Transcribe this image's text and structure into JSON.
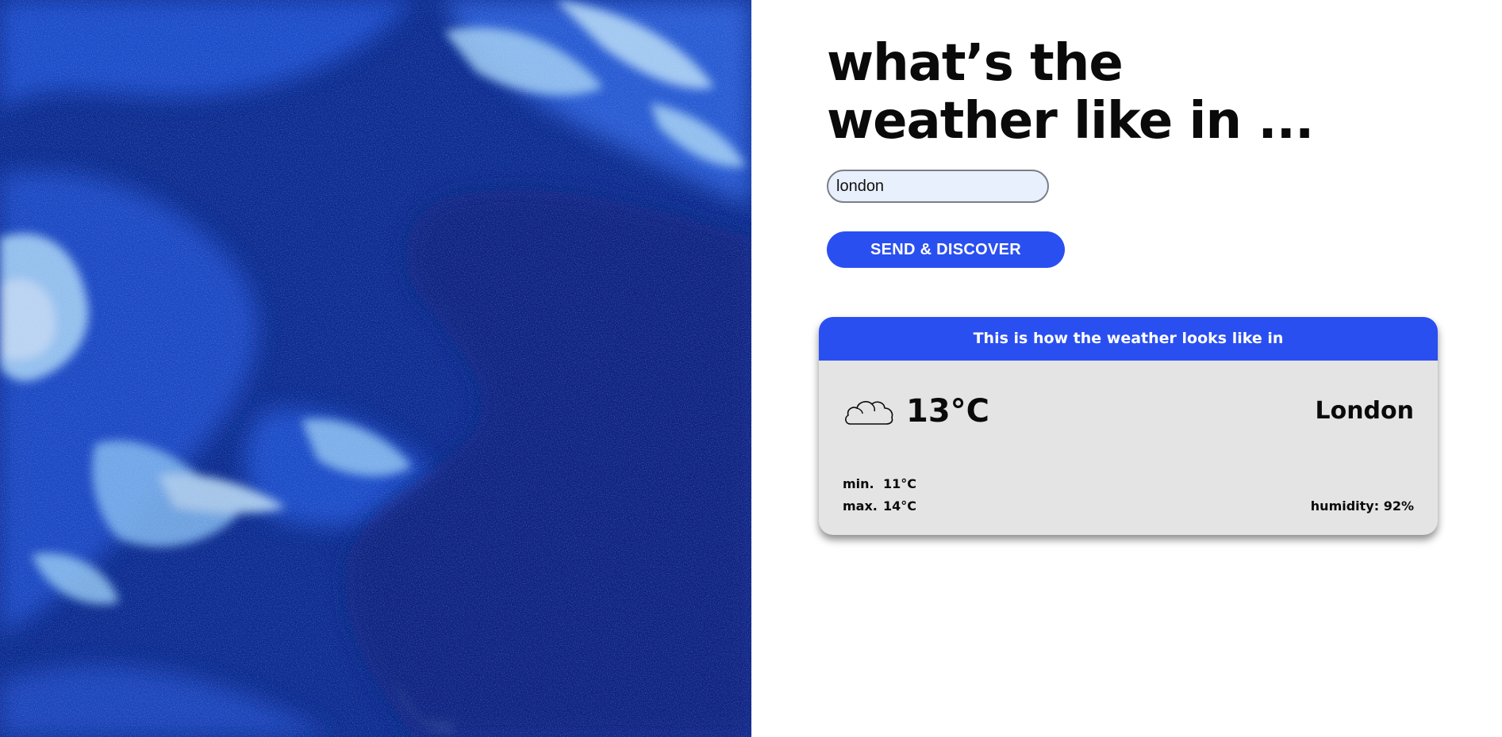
{
  "headline": {
    "line1": "what’s the",
    "line2": "weather like in ..."
  },
  "search": {
    "value": "london",
    "button_label": "SEND & DISCOVER"
  },
  "card": {
    "header": "This is how the weather looks like in",
    "icon": "cloud-icon",
    "temperature": "13°C",
    "city": "London",
    "min_label": "min.",
    "min_value": "11°C",
    "max_label": "max.",
    "max_value": "14°C",
    "humidity": "humidity: 92%"
  },
  "colors": {
    "accent": "#2a4ff0",
    "card_bg": "#e4e4e4",
    "input_bg": "#e8effd",
    "hero_dark": "#0b2a8f",
    "hero_light": "#9fd0f5"
  }
}
